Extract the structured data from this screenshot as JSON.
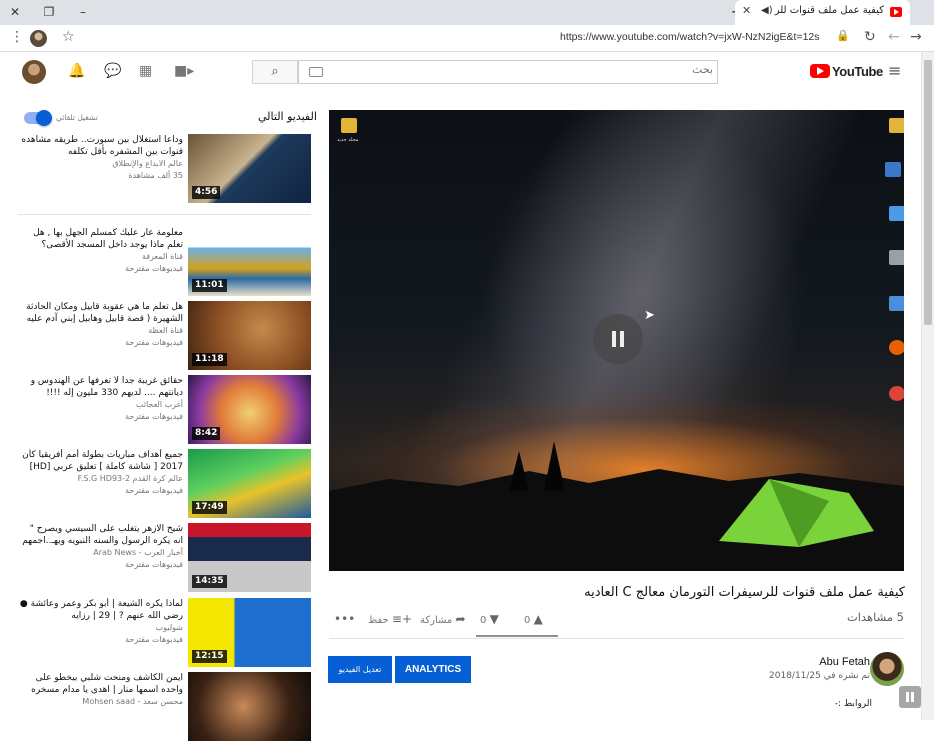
{
  "browser": {
    "tab_title": "كيفية عمل ملف قنوات للرسيفرا",
    "url": "https://www.youtube.com/watch?v=jxW-NzN2igE&t=12s"
  },
  "header": {
    "search_placeholder": "بحث",
    "logo_text": "YouTube"
  },
  "video": {
    "title": "كيفية عمل ملف قنوات للرسيفرات التورمان معالج C العاديه",
    "views": "5 مشاهدات",
    "likes": "0",
    "dislikes": "0",
    "share_label": "مشاركة",
    "save_label": "حفظ"
  },
  "channel": {
    "name": "Abu Fetah",
    "published": "تم نشره في 2018/11/25",
    "desc_label": "الروابط :-"
  },
  "buttons": {
    "analytics": "ANALYTICS",
    "edit_video": "تعديل الفيديو"
  },
  "sidebar": {
    "next_label": "الفيديو التالي",
    "autoplay_label": "تشغيل تلقائي",
    "items": [
      {
        "title": "وداعا استغلال بين سبورت.. طريقه مشاهده قنوات بين المشفره بأقل تكلفه",
        "channel": "عالم الابداع والإنطلاق",
        "extra": "35 ألف مشاهدة",
        "duration": "4:56"
      },
      {
        "title": "معلومة عار عليك كمسلم الجهل بها , هل تعلم ماذا يوجد داخل المسجد الأقصى؟",
        "channel": "قناة المعرفة",
        "extra": "فيديوهات مقترحة",
        "duration": "11:01"
      },
      {
        "title": "هل تعلم ما هي عقوبة قابيل ومكان الحادثة الشهيرة ( قصة قابيل وهابيل إبني آدم عليه",
        "channel": "قناة العظة",
        "extra": "فيديوهات مقترحة",
        "duration": "11:18"
      },
      {
        "title": "حقائق غريبة جدا لا تعرفها عن الهندوس و ديانتهم .... لديهم 330 مليون إله !!!!",
        "channel": "أغرب العجائب",
        "extra": "فيديوهات مقترحة",
        "duration": "8:42"
      },
      {
        "title": "جميع أهداف مباريات بطولة أمم أفريقيا كأن 2017 [ شاشة كاملة ] تعليق عربي [HD]",
        "channel": "عالم كرة القدم F.S.G HD93-2",
        "extra": "فيديوهات مقترحة",
        "duration": "17:49"
      },
      {
        "title": "شيخ الازهر يتغلب على السيسي ويصرح \" انه يكره الرسول والسنه النبويه ويهـ..اجمهم",
        "channel": "أخبار العرب - Arab News",
        "extra": "فيديوهات مقترحة",
        "duration": "14:35"
      },
      {
        "title": "لماذا يكره الشيعة | أبو بكر وعمر وعائشة ● رضي الله عنهم ? | 29 | رزايه",
        "channel": "شوليوب",
        "extra": "فيديوهات مقترحة",
        "duration": "12:15"
      },
      {
        "title": "ايمن الكاشف ومنحت شلبي بيخطو على واحده اسمها منار | اهدى يا مدام مسخره",
        "channel": "محسن سعد - Mohsen saad",
        "extra": "",
        "duration": ""
      }
    ]
  },
  "colors": {
    "accent_blue": "#065fd4",
    "youtube_red": "#ff0000"
  },
  "icons": [
    "hamburger-icon",
    "search-icon",
    "keyboard-icon",
    "video-camera-icon",
    "apps-icon",
    "messages-icon",
    "bell-icon",
    "like-icon",
    "dislike-icon",
    "share-icon",
    "save-icon",
    "more-icon",
    "pause-icon"
  ]
}
